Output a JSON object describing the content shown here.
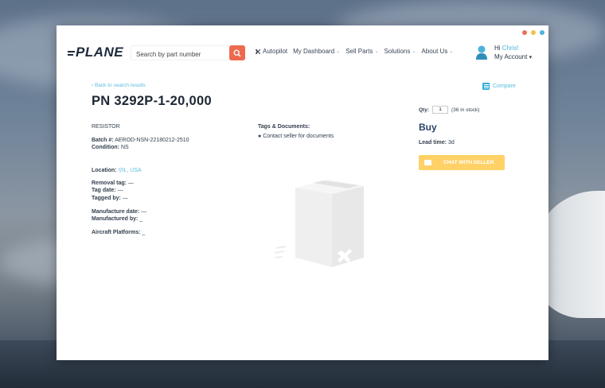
{
  "window_dots": [
    "#ef6f5c",
    "#f4c04a",
    "#4fb3dc"
  ],
  "logo": "PLANE",
  "search": {
    "placeholder": "Search by part number"
  },
  "nav": [
    {
      "label": "Autopilot",
      "icon": "plane-icon",
      "dropdown": false
    },
    {
      "label": "My Dashboard",
      "dropdown": true
    },
    {
      "label": "Sell Parts",
      "dropdown": true
    },
    {
      "label": "Solutions",
      "dropdown": true
    },
    {
      "label": "About Us",
      "dropdown": true
    }
  ],
  "account": {
    "greeting": "Hi",
    "name": "Chris!",
    "menu_label": "My Account"
  },
  "part": {
    "back_link": "Back to search results",
    "title": "PN 3292P-1-20,000",
    "category": "RESISTOR",
    "batch_label": "Batch #:",
    "batch_value": "AEROD-NSN-22180212-2510",
    "condition_label": "Condition:",
    "condition_value": "NS",
    "location_label": "Location:",
    "location_value": "IL, USA",
    "removal_tag_label": "Removal tag:",
    "removal_tag_value": "—",
    "tag_date_label": "Tag date:",
    "tag_date_value": "—",
    "tagged_by_label": "Tagged by:",
    "tagged_by_value": "—",
    "manufacture_date_label": "Manufacture date:",
    "manufacture_date_value": "—",
    "manufactured_by_label": "Manufactured by:",
    "manufactured_by_value": "_",
    "aircraft_platforms_label": "Aircraft Platforms:",
    "aircraft_platforms_value": "_",
    "tags_label": "Tags & Documents:",
    "contact_docs": "Contact seller for documents"
  },
  "purchase": {
    "compare_label": "Compare",
    "qty_label": "Qty:",
    "qty_value": "1",
    "stock": "(36 in stock)",
    "buy_label": "Buy",
    "lead_time_label": "Lead time:",
    "lead_time_value": "3d",
    "chat_button": "CHAT WITH SELLER"
  },
  "colors": {
    "accent": "#5bbbe0",
    "search_button": "#ee6a4e",
    "chat_button": "#ffd166",
    "buy": "#2b4466"
  }
}
